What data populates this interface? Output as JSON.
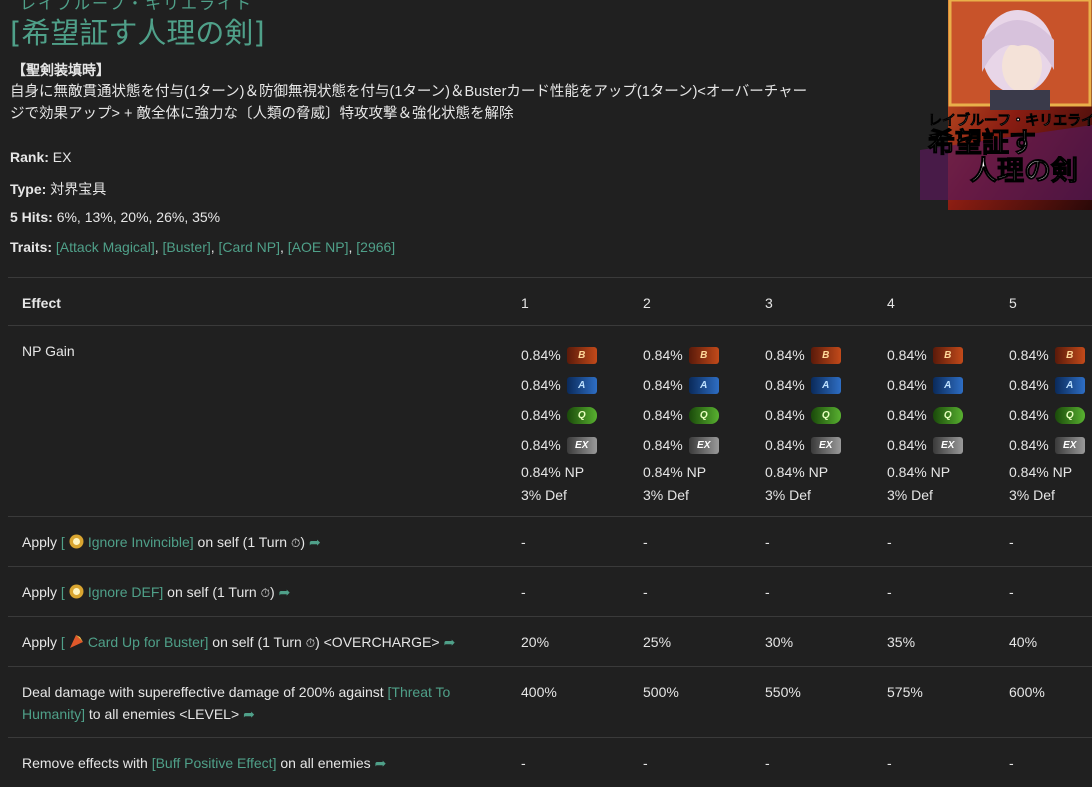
{
  "header": {
    "ruby": "レイブルーフ・キリエライト",
    "title": "[希望証す人理の剣]",
    "condition": "【聖剣装填時】",
    "description": "自身に無敵貫通状態を付与(1ターン)＆防御無視状態を付与(1ターン)＆Busterカード性能をアップ(1ターン)<オーバーチャージで効果アップ> + 敵全体に強力な〔人類の脅威〕特攻攻撃＆強化状態を解除"
  },
  "meta": {
    "rank_label": "Rank:",
    "rank_value": "EX",
    "type_label": "Type:",
    "type_value": "対界宝具",
    "hits_label": "5 Hits:",
    "hits_value": "6%, 13%, 20%, 26%, 35%",
    "traits_label": "Traits:",
    "traits": [
      "[Attack Magical]",
      "[Buster]",
      "[Card NP]",
      "[AOE NP]",
      "[2966]"
    ]
  },
  "banner": {
    "name_top": "レイブルーフ・キリエライト",
    "name_line1": "希望証す",
    "name_line2": "人理の剣"
  },
  "table": {
    "header_effect": "Effect",
    "levels": [
      "1",
      "2",
      "3",
      "4",
      "5"
    ],
    "np_gain": {
      "label": "NP Gain",
      "card_value": "0.84%",
      "np_value": "0.84% NP",
      "def_value": "3% Def",
      "cards": [
        {
          "icon": "buster-card-icon",
          "text": "B"
        },
        {
          "icon": "arts-card-icon",
          "text": "A"
        },
        {
          "icon": "quick-card-icon",
          "text": "Q"
        },
        {
          "icon": "extra-card-icon",
          "text": "EX"
        }
      ]
    },
    "rows": [
      {
        "pre": "Apply ",
        "bracket_open": "[",
        "buff": "Ignore Invincible",
        "bracket_close": "]",
        "post": " on self (1 Turn",
        "post2": ")",
        "values": [
          "-",
          "-",
          "-",
          "-",
          "-"
        ]
      },
      {
        "pre": "Apply ",
        "bracket_open": "[",
        "buff": "Ignore DEF",
        "bracket_close": "]",
        "post": " on self (1 Turn",
        "post2": ")",
        "values": [
          "-",
          "-",
          "-",
          "-",
          "-"
        ]
      },
      {
        "pre": "Apply ",
        "bracket_open": "[",
        "buff": "Card Up for Buster",
        "bracket_close": "]",
        "post": " on self (1 Turn",
        "post2": ") <OVERCHARGE>",
        "values": [
          "20%",
          "25%",
          "30%",
          "35%",
          "40%"
        ]
      },
      {
        "pre": "Deal damage with supereffective damage of 200% against ",
        "buff": "[Threat To Humanity]",
        "post": " to all enemies <LEVEL>",
        "values": [
          "400%",
          "500%",
          "550%",
          "575%",
          "600%"
        ]
      },
      {
        "pre": "Remove effects with ",
        "buff": "[Buff Positive Effect]",
        "post": " on all enemies",
        "values": [
          "-",
          "-",
          "-",
          "-",
          "-"
        ]
      }
    ]
  },
  "colors": {
    "accent": "#4fa089",
    "background": "#202020",
    "text": "#e6e6e6"
  }
}
